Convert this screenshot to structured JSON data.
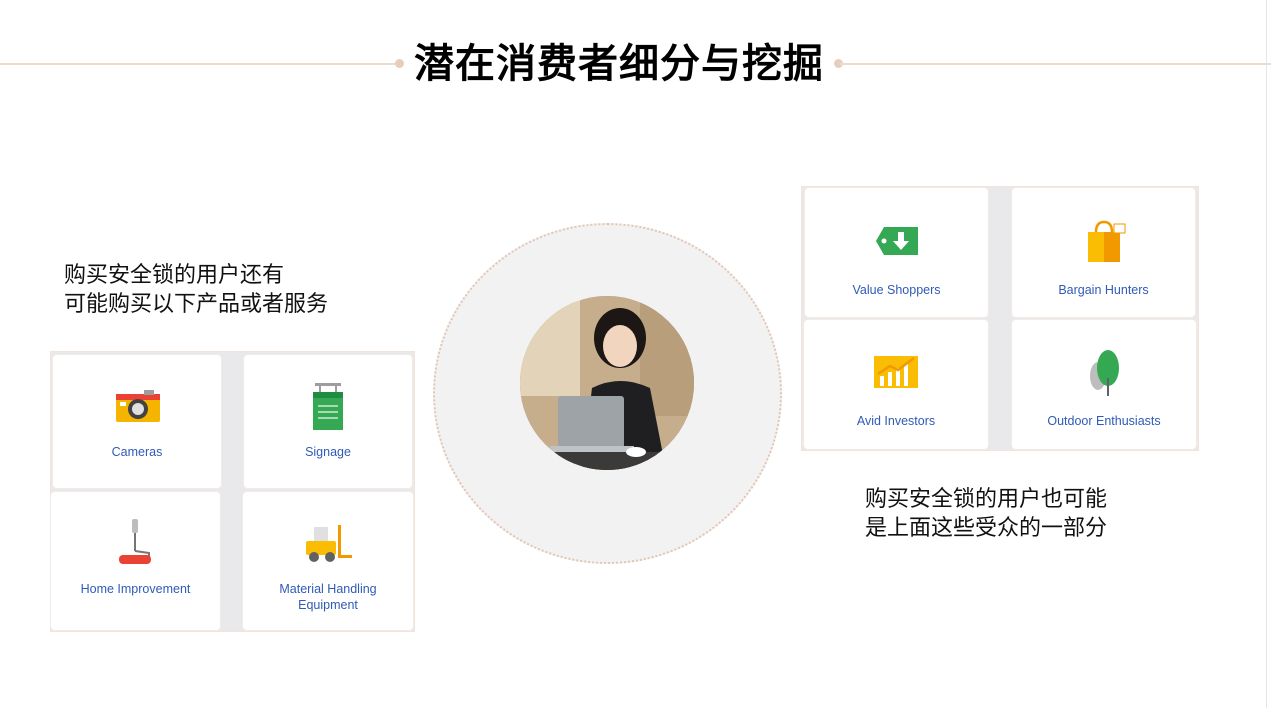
{
  "title": "潜在消费者细分与挖掘",
  "left_caption": {
    "line1": "购买安全锁的用户还有",
    "line2": "可能购买以下产品或者服务"
  },
  "right_caption": {
    "line1": "购买安全锁的用户也可能",
    "line2": "是上面这些受众的一部分"
  },
  "left_cards": [
    {
      "label": "Cameras",
      "icon": "camera-icon"
    },
    {
      "label": "Signage",
      "icon": "signage-icon"
    },
    {
      "label": "Home Improvement",
      "icon": "paint-roller-icon"
    },
    {
      "label": "Material Handling",
      "label2": "Equipment",
      "icon": "forklift-icon"
    }
  ],
  "right_cards": [
    {
      "label": "Value Shoppers",
      "icon": "price-tag-icon"
    },
    {
      "label": "Bargain Hunters",
      "icon": "shopping-bag-icon"
    },
    {
      "label": "Avid Investors",
      "icon": "growth-chart-icon"
    },
    {
      "label": "Outdoor Enthusiasts",
      "icon": "tree-icon"
    }
  ],
  "colors": {
    "label_blue": "#2f5bb7",
    "accent_line": "#ecdcd0",
    "circle_bg": "#f2f2f2"
  }
}
